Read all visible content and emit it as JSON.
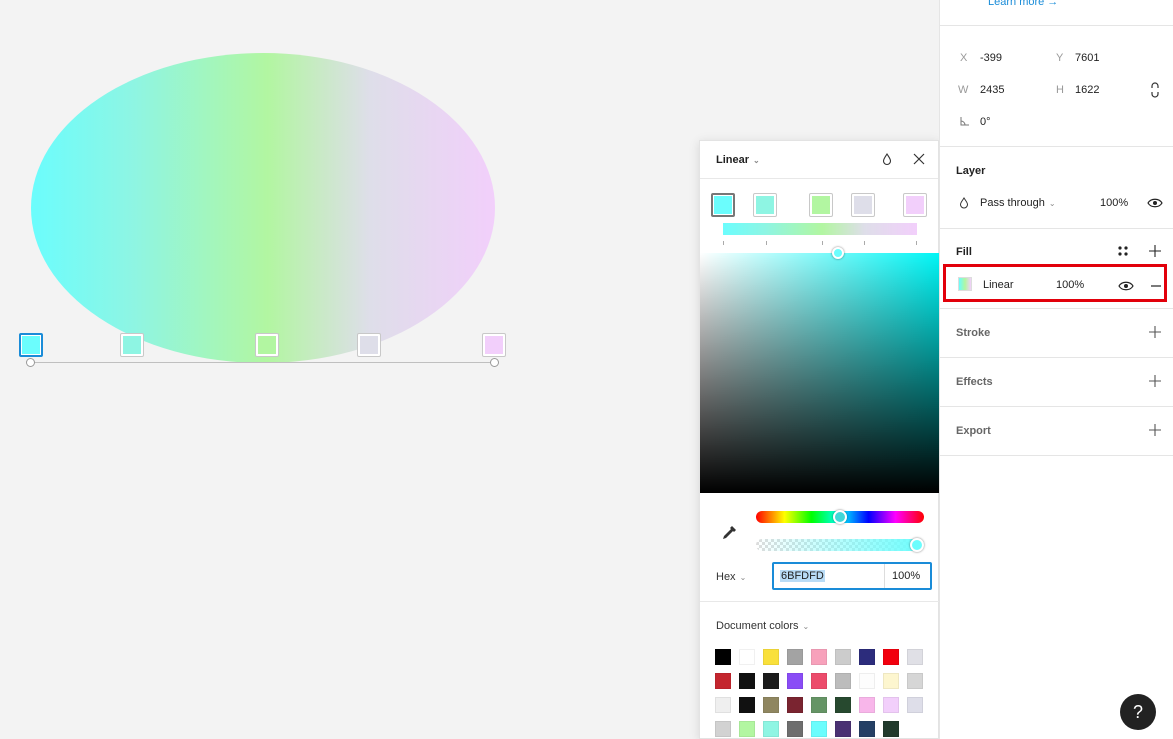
{
  "canvas": {
    "stops": [
      {
        "color": "#6BFDFD",
        "selected": true
      },
      {
        "color": "#8EF5E3",
        "selected": false
      },
      {
        "color": "#B2F6A1",
        "selected": false
      },
      {
        "color": "#DEDEE9",
        "selected": false
      },
      {
        "color": "#F2CFFB",
        "selected": false
      }
    ]
  },
  "picker": {
    "title": "Linear",
    "hex_label": "Hex",
    "hex_value": "6BFDFD",
    "opacity": "100%",
    "doc_colors_label": "Document colors",
    "document_colors": [
      "#000000",
      "#ffffff",
      "#f9e03b",
      "#a3a3a3",
      "#f7a1bb",
      "#cccccc",
      "#2c2c7c",
      "#f2000e",
      "#e0e0e6",
      "#c4262e",
      "#111111",
      "#1b1b1b",
      "#8a4cf6",
      "#ec4b6b",
      "#bcbcbc",
      "#fdfdfd",
      "#fdf6cf",
      "#d6d6d6",
      "#efefef",
      "#111111",
      "#8f8660",
      "#7a2430",
      "#659465",
      "#27492f",
      "#f8b6ea",
      "#f2cffb",
      "#dedee9",
      "#d2d2d2",
      "#b2f6a1",
      "#8ef5e3",
      "#6e6e6e",
      "#6bfdfd",
      "#4a3173",
      "#243f64",
      "#213a2c"
    ]
  },
  "right_panel": {
    "learn_more": "Learn more →",
    "x_label": "X",
    "x_value": "-399",
    "y_label": "Y",
    "y_value": "7601",
    "w_label": "W",
    "w_value": "2435",
    "h_label": "H",
    "h_value": "1622",
    "rotation": "0°",
    "layer_title": "Layer",
    "blend_mode": "Pass through",
    "layer_opacity": "100%",
    "fill_title": "Fill",
    "fill_type": "Linear",
    "fill_opacity": "100%",
    "stroke_title": "Stroke",
    "effects_title": "Effects",
    "export_title": "Export",
    "help": "?"
  }
}
